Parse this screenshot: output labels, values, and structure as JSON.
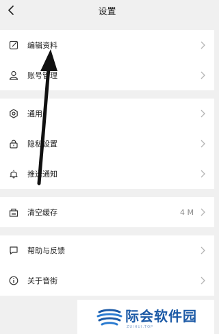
{
  "header": {
    "title": "设置"
  },
  "groups": [
    {
      "items": [
        {
          "label": "编辑资料",
          "icon": "edit-icon"
        },
        {
          "label": "账号管理",
          "icon": "person-icon"
        }
      ]
    },
    {
      "items": [
        {
          "label": "通用",
          "icon": "settings-icon"
        },
        {
          "label": "隐私设置",
          "icon": "lock-icon"
        },
        {
          "label": "推送通知",
          "icon": "bell-icon"
        }
      ]
    },
    {
      "items": [
        {
          "label": "清空缓存",
          "icon": "cache-icon",
          "value": "4 M"
        }
      ]
    },
    {
      "items": [
        {
          "label": "帮助与反馈",
          "icon": "chat-icon"
        },
        {
          "label": "关于音街",
          "icon": "info-icon"
        }
      ]
    }
  ],
  "watermark": {
    "text": "际会软件园",
    "sub": "ZUIHUI.TOP"
  },
  "colors": {
    "background": "#f0f0f0",
    "row": "#ffffff",
    "text": "#222222",
    "muted": "#888888",
    "chevron": "#b5b5b5",
    "watermark": "#1c5aa6"
  }
}
